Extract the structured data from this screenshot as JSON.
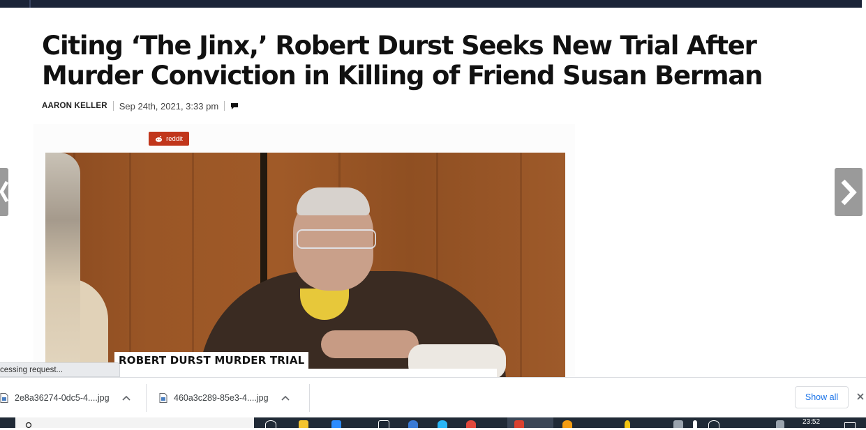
{
  "article": {
    "headline": "Citing ‘The Jinx,’ Robert Durst Seeks New Trial After Murder Conviction in Killing of Friend Susan Berman",
    "author": "AARON KELLER",
    "date": "Sep 24th, 2021, 3:33 pm",
    "comment_icon": "comment-icon"
  },
  "share": {
    "reddit_label": "reddit",
    "reddit_color": "#c1361b"
  },
  "photo": {
    "chyron": "ROBERT DURST MURDER TRIAL"
  },
  "carousel": {
    "prev_icon": "chevron-left-icon",
    "next_icon": "chevron-right-icon"
  },
  "status": {
    "text": "cessing request..."
  },
  "downloads": {
    "items": [
      {
        "filename": "2e8a36274-0dc5-4....jpg"
      },
      {
        "filename": "460a3c289-85e3-4....jpg"
      }
    ],
    "show_all_label": "Show all",
    "accent_color": "#1a73e8"
  },
  "taskbar": {
    "clock": "23:52"
  }
}
